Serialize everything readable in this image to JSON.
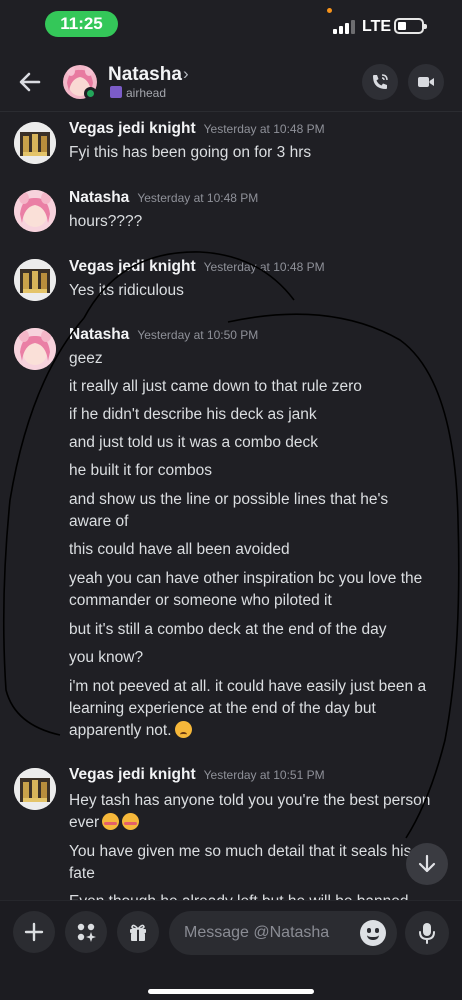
{
  "status_bar": {
    "time": "11:25",
    "network": "LTE"
  },
  "header": {
    "name": "Natasha",
    "chevron": "›",
    "status_text": "airhead",
    "icons": [
      "back-arrow-icon",
      "phone-call-icon",
      "video-camera-icon"
    ]
  },
  "messages": [
    {
      "author": "Vegas jedi knight",
      "timestamp": "Yesterday at 10:48 PM",
      "lines": [
        "Fyi this has been going on for 3 hrs"
      ]
    },
    {
      "author": "Natasha",
      "timestamp": "Yesterday at 10:48 PM",
      "lines": [
        "hours????"
      ]
    },
    {
      "author": "Vegas jedi knight",
      "timestamp": "Yesterday at 10:48 PM",
      "lines": [
        "Yes its ridiculous"
      ]
    },
    {
      "author": "Natasha",
      "timestamp": "Yesterday at 10:50 PM",
      "lines": [
        "geez",
        "it really all just came down to that rule zero",
        "if he didn't describe his deck as jank",
        "and just told us it was a combo deck",
        "he built it for combos",
        "and show us the line or possible lines that he's",
        "aware of",
        "this could have all been avoided",
        "yeah you can have other inspiration bc you love the",
        "commander or someone who piloted it",
        "but it's still a combo deck at the end of the day",
        "you know?",
        "i'm not peeved at all. it could have easily just been a",
        "learning experience at the end of the day but",
        "apparently not."
      ]
    },
    {
      "author": "Vegas jedi knight",
      "timestamp": "Yesterday at 10:51 PM",
      "lines": [
        "Hey tash has anyone told you you're the best person",
        "ever",
        "You have given me so much detail that it seals his",
        "fate",
        "Even though he already left but he will be banned"
      ]
    }
  ],
  "composer": {
    "placeholder": "Message @Natasha"
  },
  "colors": {
    "accent_green": "#34c759",
    "online": "#23a55a",
    "background": "#1f1f24"
  }
}
